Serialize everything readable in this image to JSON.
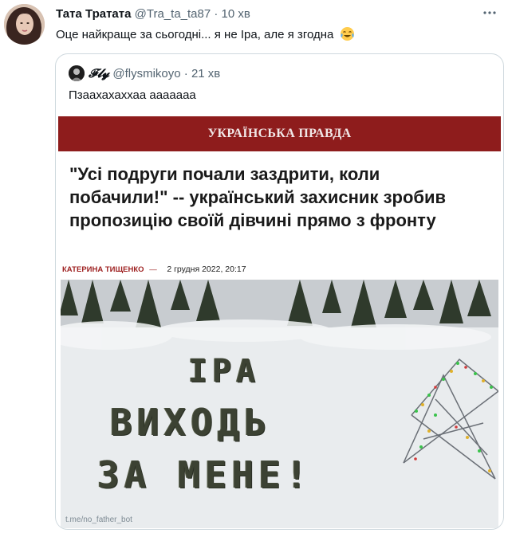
{
  "tweet": {
    "display_name": "Тата Тратата",
    "handle": "@Tra_ta_ta87",
    "dot": "·",
    "time": "10 хв",
    "more_icon": "ellipsis-icon",
    "text": "Оце найкраще за сьогодні... я не Іра, але я згодна",
    "emoji": "face-with-tears-of-joy"
  },
  "quoted": {
    "display_name": "𝓕𝓵𝔂",
    "handle": "@flysmikoyo",
    "dot": "·",
    "time": "21 хв",
    "text": "Пзаахахаххаа ааааааа"
  },
  "article": {
    "masthead": "УКРАЇНСЬКА ПРАВДА",
    "headline_line1": "\"Усі подруги почали заздрити, коли",
    "headline_line2": "побачили!\" -- український захисник зробив",
    "headline_line3": "пропозицію своїй дівчині прямо з фронту",
    "author": "КАТЕРИНА ТИЩЕНКО",
    "separator": "—",
    "date": "2 грудня 2022, 20:17",
    "photo_line1": "ІРА",
    "photo_line2": "ВИХОДЬ",
    "photo_line3": "ЗА МЕНЕ!",
    "watermark": "t.me/no_father_bot"
  },
  "colors": {
    "masthead_bg": "#8e1c1c",
    "author": "#9d1f1f",
    "secondary_text": "#536471",
    "border": "#cfd9de"
  }
}
